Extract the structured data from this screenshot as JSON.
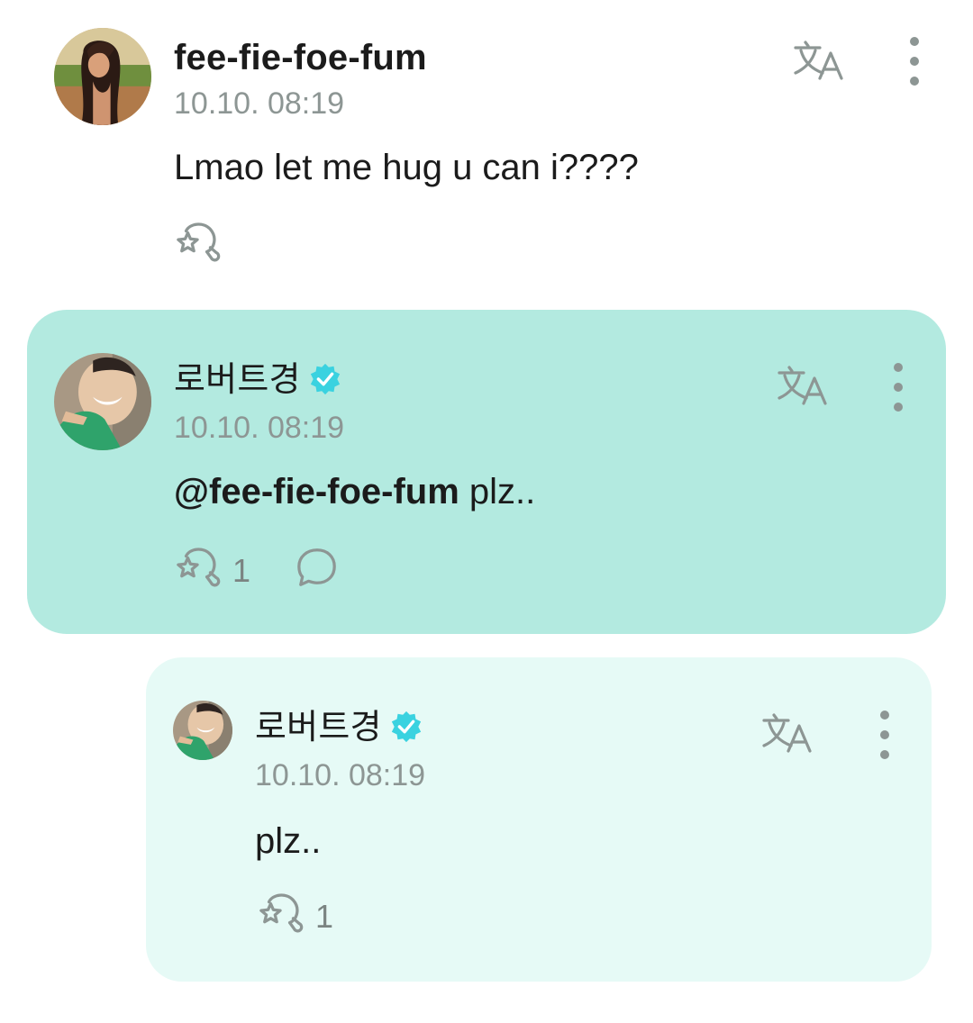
{
  "colors": {
    "highlight_bg": "#b3eae0",
    "reply_bg": "#e6faf6",
    "verified": "#3ad2e0",
    "icon_gray": "#8d9694"
  },
  "comments": [
    {
      "author": "fee-fie-foe-fum",
      "verified": false,
      "timestamp": "10.10. 08:19",
      "text": "Lmao let me hug u can i????",
      "like_count": "",
      "icons": [
        "translate-icon",
        "more-vertical-icon",
        "like-icon"
      ]
    },
    {
      "author": "로버트경",
      "verified": true,
      "timestamp": "10.10. 08:19",
      "mention": "@fee-fie-foe-fum",
      "text": " plz..",
      "like_count": "1",
      "icons": [
        "translate-icon",
        "more-vertical-icon",
        "like-icon",
        "reply-icon"
      ]
    },
    {
      "author": "로버트경",
      "verified": true,
      "timestamp": "10.10. 08:19",
      "text": "plz..",
      "like_count": "1",
      "icons": [
        "translate-icon",
        "more-vertical-icon",
        "like-icon"
      ]
    }
  ]
}
